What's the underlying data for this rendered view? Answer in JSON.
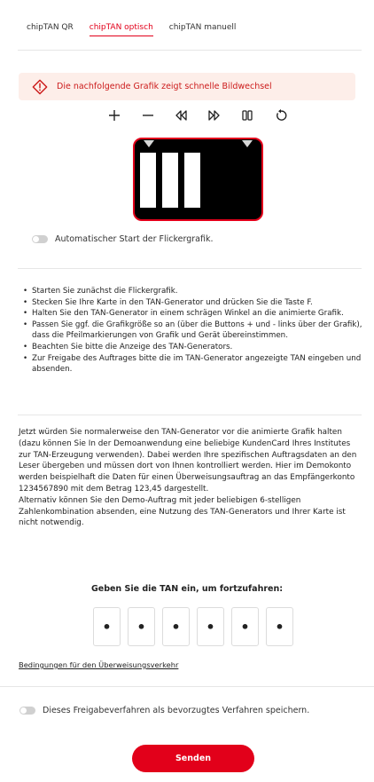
{
  "tabs": [
    {
      "label": "chipTAN QR",
      "active": false
    },
    {
      "label": "chipTAN optisch",
      "active": true
    },
    {
      "label": "chipTAN manuell",
      "active": false
    }
  ],
  "warning": {
    "text": "Die nachfolgende Grafik zeigt schnelle Bildwechsel",
    "icon": "warning-diamond-icon",
    "color": "#cc1b1b"
  },
  "toolbar": {
    "zoom_in": "+",
    "zoom_out": "—",
    "icons": [
      "plus-icon",
      "minus-icon",
      "slower-icon",
      "faster-icon",
      "pause-icon",
      "restart-icon"
    ]
  },
  "auto_start": {
    "label": "Automatischer Start der Flickergrafik.",
    "enabled": false
  },
  "instructions": [
    "Starten Sie zunächst die Flickergrafik.",
    "Stecken Sie Ihre Karte in den TAN-Generator und drücken Sie die Taste F.",
    "Halten Sie den TAN-Generator in einem schrägen Winkel an die animierte Grafik.",
    "Passen Sie ggf. die Grafikgröße so an (über die Buttons + und - links über der Grafik), dass die Pfeilmarkierungen von Grafik und Gerät übereinstimmen.",
    "Beachten Sie bitte die Anzeige des TAN-Generators.",
    "Zur Freigabe des Auftrages bitte die im TAN-Generator angezeigte TAN eingeben und absenden."
  ],
  "description": "Jetzt würden Sie normalerweise den TAN-Generator vor die animierte Grafik halten (dazu können Sie In der Demoanwendung eine beliebige KundenCard Ihres Institutes zur TAN-Erzeugung verwenden). Dabei werden Ihre spezifischen Auftragsdaten an den Leser übergeben und müssen dort von Ihnen kontrolliert werden. Hier im Demokonto werden beispielhaft die Daten für einen Überweisungsauftrag an das Empfängerkonto 1234567890 mit dem Betrag 123,45 dargestellt.",
  "description2": "Alternativ können Sie den Demo-Auftrag mit jeder beliebigen 6-stelligen Zahlenkombination absenden, eine Nutzung des TAN-Generators und Ihrer Karte ist nicht notwendig.",
  "tan": {
    "heading": "Geben Sie die TAN ein, um fortzufahren:",
    "digits": [
      "•",
      "•",
      "•",
      "•",
      "•",
      "•"
    ]
  },
  "terms_link": "Bedingungen für den Überweisungsverkehr",
  "preferred": {
    "label": "Dieses Freigabeverfahren als bevorzugtes Verfahren speichern.",
    "enabled": false
  },
  "submit_label": "Senden",
  "colors": {
    "accent": "#e2001a",
    "warning_bg": "#fdeee9"
  }
}
